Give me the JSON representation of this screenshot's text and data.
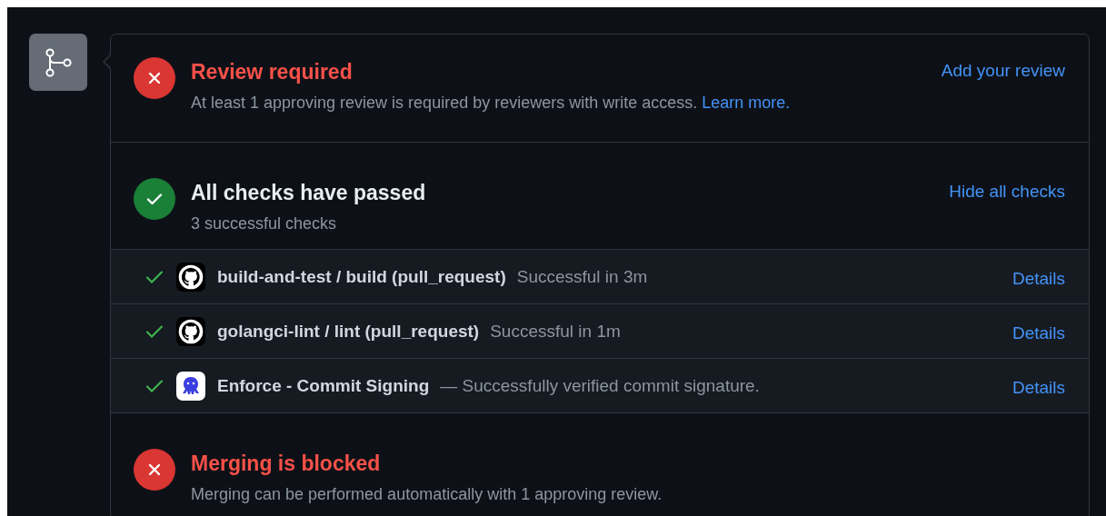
{
  "sections": [
    {
      "kind": "status",
      "passed": false,
      "title": "Review required",
      "description": "At least 1 approving review is required by reviewers with write access.",
      "link": "Learn more.",
      "action": "Add your review"
    },
    {
      "kind": "status",
      "passed": true,
      "title": "All checks have passed",
      "description": "3 successful checks",
      "action": "Hide all checks"
    },
    {
      "kind": "checks",
      "checks": [
        {
          "passed": true,
          "kind": "github",
          "name": "build-and-test / build (pull_request)",
          "description": "Successful in 3m",
          "action": "Details"
        },
        {
          "passed": true,
          "kind": "github",
          "name": "golangci-lint / lint (pull_request)",
          "description": "Successful in 1m",
          "action": "Details"
        },
        {
          "passed": true,
          "kind": "octopus",
          "name": "Enforce - Commit Signing",
          "description": "— Successfully verified commit signature.",
          "action": "Details"
        }
      ]
    },
    {
      "kind": "status",
      "passed": false,
      "title": "Merging is blocked",
      "description": "Merging can be performed automatically with 1 approving review."
    }
  ]
}
